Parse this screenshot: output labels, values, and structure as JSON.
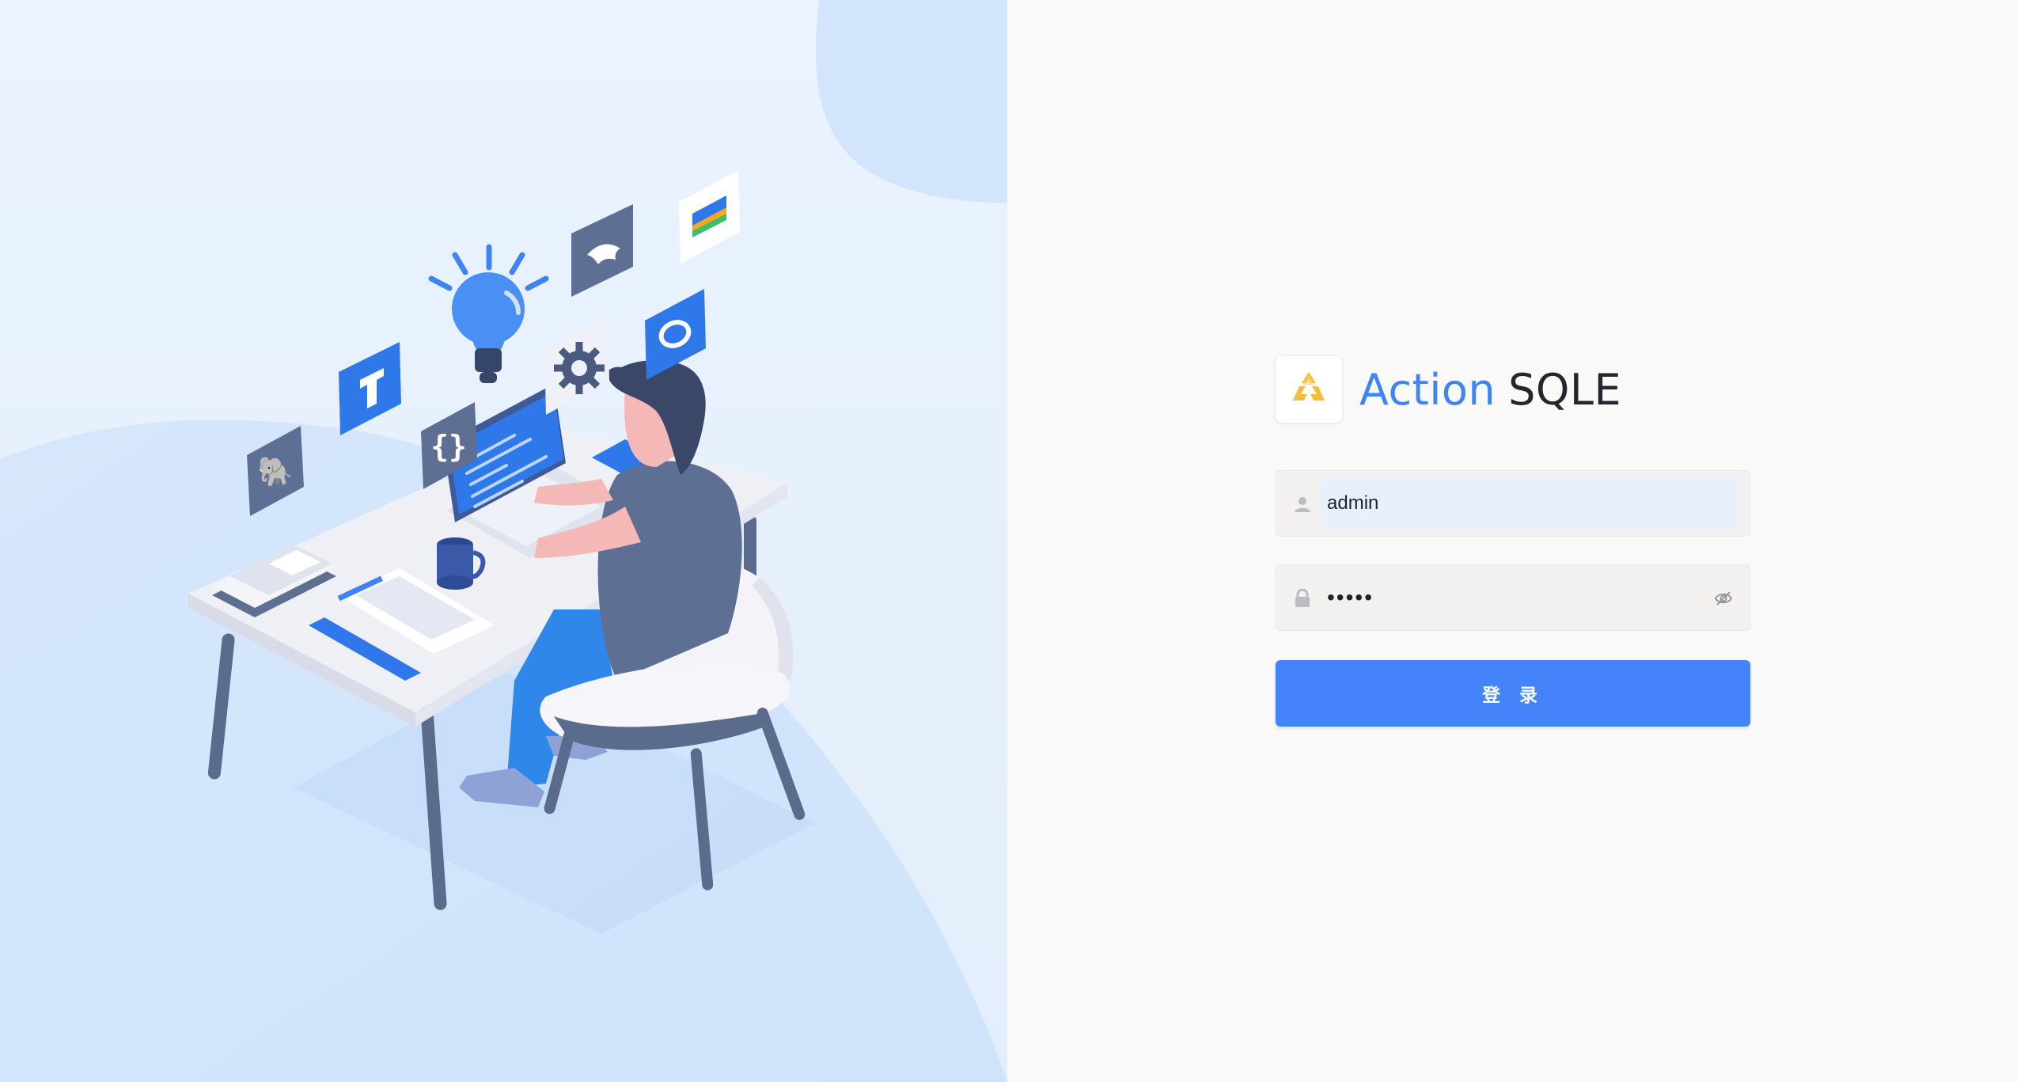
{
  "brand": {
    "name_part1": "Action",
    "name_part2": "SQLE",
    "logo_icon": "recycle-logo-icon",
    "accent_color": "#3f84f7"
  },
  "login_form": {
    "username": {
      "value": "admin",
      "icon": "user-icon"
    },
    "password": {
      "value": "•••••",
      "icon": "lock-icon",
      "toggle_icon": "eye-invisible-icon"
    },
    "submit_label": "登 录"
  },
  "illustration": {
    "description_icons": [
      "postgresql-icon",
      "tidb-icon",
      "code-braces-icon",
      "lightbulb-icon",
      "gear-icon",
      "mysql-dolphin-icon",
      "oracle-icon",
      "chart-card-icon"
    ]
  },
  "colors": {
    "primary_button": "#4583fa",
    "left_background": "#e9f2fd",
    "right_background": "#faf9f7"
  }
}
